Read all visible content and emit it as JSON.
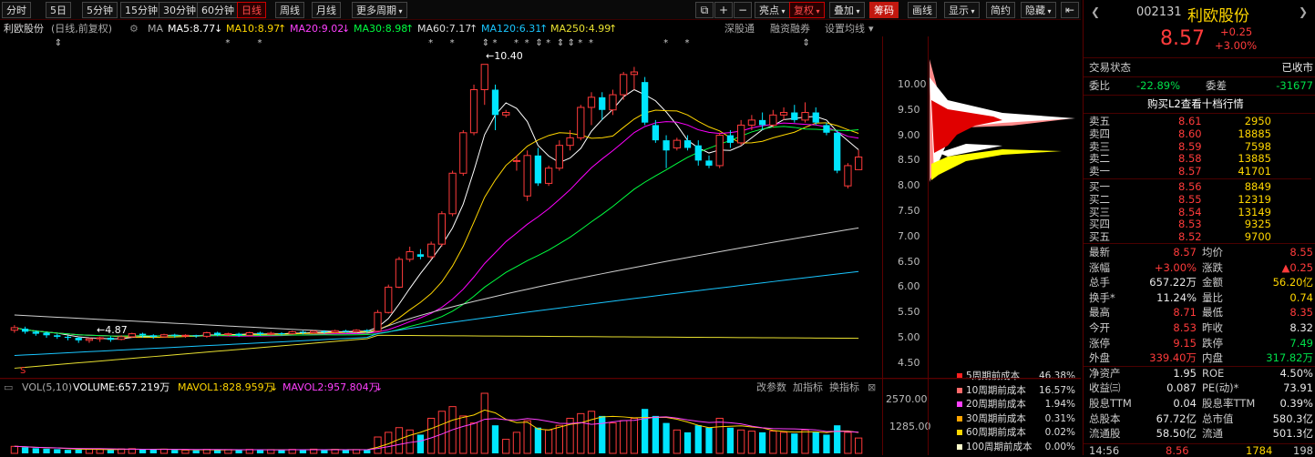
{
  "toolbar": {
    "periods": [
      "分时",
      "5日",
      "5分钟",
      "15分钟",
      "30分钟",
      "60分钟",
      "日线",
      "周线",
      "月线",
      "更多周期"
    ],
    "active_period": "日线",
    "right_tools": [
      "亮点",
      "复权",
      "叠加",
      "筹码",
      "画线",
      "显示",
      "简约",
      "隐藏"
    ]
  },
  "ma_bar": {
    "stock": "利欧股份",
    "mode": "(日线,前复权)",
    "ma_label": "MA",
    "ma5": "MA5:8.77",
    "ma10": "MA10:8.97",
    "ma20": "MA20:9.02",
    "ma30": "MA30:8.98",
    "ma60": "MA60:7.17",
    "ma120": "MA120:6.31",
    "ma250": "MA250:4.99",
    "links": [
      "深股通",
      "融资融券",
      "设置均线"
    ],
    "colors": {
      "ma5": "#ffffff",
      "ma10": "#ffd600",
      "ma20": "#ff00ff",
      "ma30": "#00ff40",
      "ma60": "#d0d0d0",
      "ma120": "#19c6ff",
      "ma250": "#e8e030"
    }
  },
  "chart": {
    "high_label": "10.40",
    "low_label": "4.87",
    "y_ticks": [
      "10.00",
      "9.50",
      "9.00",
      "8.50",
      "8.00",
      "7.50",
      "7.00",
      "6.50",
      "6.00",
      "5.50",
      "5.00",
      "4.50"
    ]
  },
  "volume_bar": {
    "label": "VOL(5,10)",
    "volume": "VOLUME:657.219万",
    "mavol1": "MAVOL1:828.959万",
    "mavol2": "MAVOL2:957.804万",
    "links": [
      "改参数",
      "加指标",
      "换指标"
    ],
    "y_ticks": [
      "2570.00",
      "1285.00"
    ]
  },
  "cost_legend": [
    {
      "label": "5周期前成本",
      "value": "46.38%",
      "color": "#ff2020"
    },
    {
      "label": "10周期前成本",
      "value": "16.57%",
      "color": "#ff6a6a"
    },
    {
      "label": "20周期前成本",
      "value": "1.94%",
      "color": "#ff40ff"
    },
    {
      "label": "30周期前成本",
      "value": "0.31%",
      "color": "#ffa500"
    },
    {
      "label": "60周期前成本",
      "value": "0.02%",
      "color": "#ffd600"
    },
    {
      "label": "100周期前成本",
      "value": "0.00%",
      "color": "#ffffcc"
    }
  ],
  "quote": {
    "code": "002131",
    "name": "利欧股份",
    "price": "8.57",
    "change": "+0.25",
    "change_pct": "+3.00%",
    "status_label": "交易状态",
    "status_value": "已收市",
    "weibi_label": "委比",
    "weibi_value": "-22.89%",
    "weicha_label": "委差",
    "weicha_value": "-31677",
    "l2_link": "购买L2查看十档行情",
    "asks": [
      {
        "label": "卖五",
        "price": "8.61",
        "vol": "2950"
      },
      {
        "label": "卖四",
        "price": "8.60",
        "vol": "18885"
      },
      {
        "label": "卖三",
        "price": "8.59",
        "vol": "7598"
      },
      {
        "label": "卖二",
        "price": "8.58",
        "vol": "13885"
      },
      {
        "label": "卖一",
        "price": "8.57",
        "vol": "41701"
      }
    ],
    "bids": [
      {
        "label": "买一",
        "price": "8.56",
        "vol": "8849"
      },
      {
        "label": "买二",
        "price": "8.55",
        "vol": "12319"
      },
      {
        "label": "买三",
        "price": "8.54",
        "vol": "13149"
      },
      {
        "label": "买四",
        "price": "8.53",
        "vol": "9325"
      },
      {
        "label": "买五",
        "price": "8.52",
        "vol": "9700"
      }
    ],
    "stats": [
      {
        "l1": "最新",
        "v1": "8.57",
        "c1": "red",
        "l2": "均价",
        "v2": "8.55",
        "c2": "red"
      },
      {
        "l1": "涨幅",
        "v1": "+3.00%",
        "c1": "red",
        "l2": "涨跌",
        "v2": "▲0.25",
        "c2": "red"
      },
      {
        "l1": "总手",
        "v1": "657.22万",
        "c1": "white",
        "l2": "金额",
        "v2": "56.20亿",
        "c2": "yel"
      },
      {
        "l1": "换手*",
        "v1": "11.24%",
        "c1": "white",
        "l2": "量比",
        "v2": "0.74",
        "c2": "yel"
      },
      {
        "l1": "最高",
        "v1": "8.71",
        "c1": "red",
        "l2": "最低",
        "v2": "8.35",
        "c2": "red"
      },
      {
        "l1": "今开",
        "v1": "8.53",
        "c1": "red",
        "l2": "昨收",
        "v2": "8.32",
        "c2": "white"
      },
      {
        "l1": "涨停",
        "v1": "9.15",
        "c1": "red",
        "l2": "跌停",
        "v2": "7.49",
        "c2": "green"
      },
      {
        "l1": "外盘",
        "v1": "339.40万",
        "c1": "red",
        "l2": "内盘",
        "v2": "317.82万",
        "c2": "green"
      },
      {
        "l1": "净资产",
        "v1": "1.95",
        "c1": "white",
        "l2": "ROE",
        "v2": "4.50%",
        "c2": "white"
      },
      {
        "l1": "收益㈢",
        "v1": "0.087",
        "c1": "white",
        "l2": "PE(动)*",
        "v2": "73.91",
        "c2": "white"
      },
      {
        "l1": "股息TTM",
        "v1": "0.04",
        "c1": "white",
        "l2": "股息率TTM",
        "v2": "0.39%",
        "c2": "white"
      },
      {
        "l1": "总股本",
        "v1": "67.72亿",
        "c1": "white",
        "l2": "总市值",
        "v2": "580.3亿",
        "c2": "white"
      },
      {
        "l1": "流通股",
        "v1": "58.50亿",
        "c1": "white",
        "l2": "流通",
        "v2": "501.3亿",
        "c2": "white"
      }
    ],
    "tick": {
      "time": "14:56",
      "price": "8.56",
      "vol": "1784",
      "count": "198"
    }
  },
  "chart_data": {
    "type": "candlestick",
    "y_range": [
      4.3,
      10.7
    ],
    "candles": [
      [
        5.15,
        5.2,
        5.1,
        5.25,
        "up"
      ],
      [
        5.18,
        5.12,
        5.08,
        5.22,
        "down"
      ],
      [
        5.12,
        5.08,
        5.04,
        5.15,
        "down"
      ],
      [
        5.1,
        5.05,
        5.0,
        5.12,
        "down"
      ],
      [
        5.05,
        5.02,
        4.98,
        5.08,
        "down"
      ],
      [
        5.02,
        5.0,
        4.95,
        5.05,
        "down"
      ],
      [
        5.0,
        4.95,
        4.9,
        5.02,
        "down"
      ],
      [
        4.95,
        4.98,
        4.9,
        5.0,
        "up"
      ],
      [
        4.98,
        5.0,
        4.92,
        5.02,
        "up"
      ],
      [
        5.0,
        4.96,
        4.92,
        5.03,
        "down"
      ],
      [
        4.97,
        5.02,
        4.95,
        5.05,
        "up"
      ],
      [
        5.02,
        5.08,
        5.0,
        5.1,
        "up"
      ],
      [
        5.08,
        5.05,
        5.0,
        5.1,
        "down"
      ],
      [
        5.05,
        5.02,
        4.98,
        5.07,
        "down"
      ],
      [
        5.02,
        5.06,
        5.0,
        5.08,
        "up"
      ],
      [
        5.06,
        5.04,
        5.0,
        5.08,
        "down"
      ],
      [
        5.04,
        5.05,
        5.0,
        5.07,
        "up"
      ],
      [
        5.05,
        5.03,
        5.0,
        5.06,
        "down"
      ],
      [
        5.03,
        5.1,
        5.0,
        5.12,
        "up"
      ],
      [
        5.1,
        5.06,
        5.03,
        5.12,
        "down"
      ],
      [
        5.06,
        5.08,
        5.03,
        5.1,
        "up"
      ],
      [
        5.08,
        5.05,
        5.02,
        5.1,
        "down"
      ],
      [
        5.05,
        5.1,
        5.03,
        5.12,
        "up"
      ],
      [
        5.1,
        5.07,
        5.04,
        5.12,
        "down"
      ],
      [
        5.07,
        5.09,
        5.05,
        5.12,
        "up"
      ],
      [
        5.09,
        5.08,
        5.05,
        5.11,
        "down"
      ],
      [
        5.08,
        5.12,
        5.06,
        5.14,
        "up"
      ],
      [
        5.12,
        5.1,
        5.07,
        5.14,
        "down"
      ],
      [
        5.1,
        5.13,
        5.08,
        5.15,
        "up"
      ],
      [
        5.13,
        5.11,
        5.08,
        5.15,
        "down"
      ],
      [
        5.11,
        5.14,
        5.09,
        5.16,
        "up"
      ],
      [
        5.14,
        5.12,
        5.1,
        5.16,
        "down"
      ],
      [
        5.12,
        5.15,
        5.1,
        5.17,
        "up"
      ],
      [
        5.15,
        5.13,
        5.1,
        5.17,
        "down"
      ],
      [
        5.13,
        5.5,
        5.12,
        5.55,
        "up"
      ],
      [
        5.5,
        6.0,
        5.48,
        6.05,
        "up"
      ],
      [
        6.0,
        6.55,
        5.98,
        6.6,
        "up"
      ],
      [
        6.55,
        6.7,
        6.5,
        6.8,
        "up"
      ],
      [
        6.65,
        6.6,
        6.55,
        6.75,
        "down"
      ],
      [
        6.6,
        6.85,
        6.55,
        6.9,
        "up"
      ],
      [
        6.85,
        7.45,
        6.8,
        7.5,
        "up"
      ],
      [
        7.45,
        8.25,
        7.4,
        8.3,
        "up"
      ],
      [
        8.25,
        9.05,
        8.2,
        9.1,
        "up"
      ],
      [
        9.05,
        9.9,
        9.0,
        10.0,
        "up"
      ],
      [
        9.9,
        10.4,
        9.6,
        10.4,
        "up"
      ],
      [
        9.9,
        9.4,
        9.1,
        10.0,
        "down"
      ],
      [
        9.4,
        9.45,
        9.35,
        9.5,
        "up"
      ],
      [
        8.5,
        8.5,
        8.3,
        8.6,
        "up"
      ],
      [
        7.8,
        8.6,
        7.7,
        8.7,
        "up"
      ],
      [
        8.6,
        8.05,
        8.0,
        8.75,
        "down"
      ],
      [
        8.05,
        8.35,
        8.0,
        8.4,
        "up"
      ],
      [
        8.35,
        8.8,
        8.3,
        8.9,
        "up"
      ],
      [
        8.8,
        8.95,
        8.7,
        9.1,
        "up"
      ],
      [
        8.95,
        9.55,
        8.9,
        9.6,
        "up"
      ],
      [
        9.55,
        9.75,
        9.2,
        9.85,
        "up"
      ],
      [
        9.75,
        9.5,
        9.3,
        9.85,
        "down"
      ],
      [
        9.5,
        9.8,
        9.4,
        9.9,
        "up"
      ],
      [
        9.8,
        10.2,
        9.7,
        10.25,
        "up"
      ],
      [
        10.2,
        10.25,
        9.9,
        10.35,
        "up"
      ],
      [
        10.05,
        9.25,
        9.2,
        10.15,
        "down"
      ],
      [
        9.2,
        8.9,
        8.85,
        9.3,
        "down"
      ],
      [
        8.9,
        8.7,
        8.35,
        9.0,
        "down"
      ],
      [
        8.75,
        8.9,
        8.7,
        8.95,
        "up"
      ],
      [
        8.9,
        8.75,
        8.7,
        9.0,
        "down"
      ],
      [
        8.8,
        8.5,
        8.4,
        8.9,
        "down"
      ],
      [
        8.5,
        8.4,
        8.35,
        8.6,
        "down"
      ],
      [
        8.4,
        9.0,
        8.35,
        9.05,
        "up"
      ],
      [
        9.0,
        8.85,
        8.75,
        9.1,
        "down"
      ],
      [
        8.85,
        9.2,
        8.8,
        9.3,
        "up"
      ],
      [
        9.2,
        9.3,
        9.1,
        9.4,
        "up"
      ],
      [
        9.3,
        9.2,
        9.1,
        9.45,
        "down"
      ],
      [
        9.2,
        9.4,
        9.15,
        9.5,
        "up"
      ],
      [
        9.4,
        9.45,
        9.3,
        9.55,
        "up"
      ],
      [
        9.45,
        9.3,
        9.25,
        9.6,
        "down"
      ],
      [
        9.3,
        9.45,
        9.25,
        9.65,
        "up"
      ],
      [
        9.45,
        9.25,
        9.2,
        9.55,
        "down"
      ],
      [
        9.2,
        9.05,
        9.0,
        9.25,
        "down"
      ],
      [
        9.05,
        8.3,
        8.25,
        9.1,
        "down"
      ],
      [
        8.0,
        8.4,
        7.95,
        8.45,
        "up"
      ],
      [
        8.32,
        8.57,
        8.35,
        8.71,
        "up"
      ]
    ],
    "volumes": [
      [
        300,
        "up"
      ],
      [
        260,
        "down"
      ],
      [
        220,
        "down"
      ],
      [
        200,
        "down"
      ],
      [
        180,
        "down"
      ],
      [
        150,
        "down"
      ],
      [
        160,
        "down"
      ],
      [
        180,
        "up"
      ],
      [
        170,
        "up"
      ],
      [
        150,
        "down"
      ],
      [
        190,
        "up"
      ],
      [
        200,
        "up"
      ],
      [
        170,
        "down"
      ],
      [
        160,
        "down"
      ],
      [
        180,
        "up"
      ],
      [
        150,
        "down"
      ],
      [
        140,
        "up"
      ],
      [
        130,
        "down"
      ],
      [
        170,
        "up"
      ],
      [
        150,
        "down"
      ],
      [
        160,
        "up"
      ],
      [
        140,
        "down"
      ],
      [
        170,
        "up"
      ],
      [
        150,
        "down"
      ],
      [
        160,
        "up"
      ],
      [
        140,
        "down"
      ],
      [
        170,
        "up"
      ],
      [
        150,
        "down"
      ],
      [
        180,
        "up"
      ],
      [
        150,
        "down"
      ],
      [
        170,
        "up"
      ],
      [
        140,
        "down"
      ],
      [
        160,
        "up"
      ],
      [
        150,
        "down"
      ],
      [
        700,
        "up"
      ],
      [
        900,
        "up"
      ],
      [
        1100,
        "up"
      ],
      [
        1000,
        "up"
      ],
      [
        800,
        "down"
      ],
      [
        1500,
        "up"
      ],
      [
        1800,
        "up"
      ],
      [
        2000,
        "up"
      ],
      [
        1600,
        "up"
      ],
      [
        1300,
        "up"
      ],
      [
        2570,
        "up"
      ],
      [
        1200,
        "down"
      ],
      [
        600,
        "up"
      ],
      [
        900,
        "up"
      ],
      [
        1400,
        "up"
      ],
      [
        1100,
        "down"
      ],
      [
        1000,
        "up"
      ],
      [
        1200,
        "up"
      ],
      [
        1500,
        "up"
      ],
      [
        1700,
        "up"
      ],
      [
        1800,
        "up"
      ],
      [
        1600,
        "down"
      ],
      [
        1300,
        "up"
      ],
      [
        1400,
        "up"
      ],
      [
        1500,
        "up"
      ],
      [
        1900,
        "down"
      ],
      [
        1600,
        "down"
      ],
      [
        1300,
        "down"
      ],
      [
        1000,
        "up"
      ],
      [
        900,
        "down"
      ],
      [
        1200,
        "down"
      ],
      [
        1100,
        "down"
      ],
      [
        1500,
        "up"
      ],
      [
        1100,
        "down"
      ],
      [
        1000,
        "up"
      ],
      [
        950,
        "up"
      ],
      [
        900,
        "down"
      ],
      [
        950,
        "up"
      ],
      [
        900,
        "up"
      ],
      [
        850,
        "down"
      ],
      [
        1000,
        "up"
      ],
      [
        900,
        "down"
      ],
      [
        800,
        "down"
      ],
      [
        1200,
        "down"
      ],
      [
        900,
        "up"
      ],
      [
        657,
        "up"
      ]
    ]
  }
}
